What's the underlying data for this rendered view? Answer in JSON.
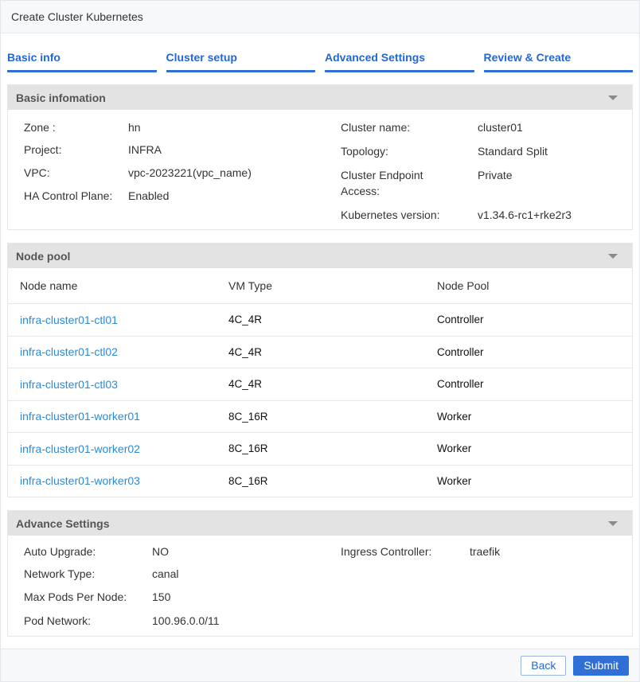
{
  "window": {
    "title": "Create Cluster Kubernetes"
  },
  "steps": [
    {
      "label": "Basic info"
    },
    {
      "label": "Cluster setup"
    },
    {
      "label": "Advanced Settings"
    },
    {
      "label": "Review & Create"
    }
  ],
  "basic": {
    "title": "Basic infomation",
    "left": [
      {
        "key": "Zone :",
        "value": "hn"
      },
      {
        "key": "Project:",
        "value": "INFRA"
      },
      {
        "key": "VPC:",
        "value": "vpc-2023221(vpc_name)"
      },
      {
        "key": "HA Control Plane:",
        "value": "Enabled"
      }
    ],
    "right": [
      {
        "key": "Cluster name:",
        "value": "cluster01"
      },
      {
        "key": "Topology:",
        "value": "Standard Split"
      },
      {
        "key_line1": "Cluster Endpoint",
        "key_line2": "Access:",
        "value": "Private"
      },
      {
        "key": "Kubernetes version:",
        "value": "v1.34.6-rc1+rke2r3"
      }
    ]
  },
  "nodepool": {
    "title": "Node pool",
    "headers": [
      "Node name",
      "VM Type",
      "Node Pool"
    ],
    "rows": [
      {
        "name": "infra-cluster01-ctl01",
        "vm": "4C_4R",
        "pool": "Controller"
      },
      {
        "name": "infra-cluster01-ctl02",
        "vm": "4C_4R",
        "pool": "Controller"
      },
      {
        "name": "infra-cluster01-ctl03",
        "vm": "4C_4R",
        "pool": "Controller"
      },
      {
        "name": "infra-cluster01-worker01",
        "vm": "8C_16R",
        "pool": "Worker"
      },
      {
        "name": "infra-cluster01-worker02",
        "vm": "8C_16R",
        "pool": "Worker"
      },
      {
        "name": "infra-cluster01-worker03",
        "vm": "8C_16R",
        "pool": "Worker"
      }
    ]
  },
  "advance": {
    "title": "Advance Settings",
    "left": [
      {
        "key": "Auto Upgrade:",
        "value": "NO"
      },
      {
        "key": "Network Type:",
        "value": "canal"
      },
      {
        "key": "Max Pods Per Node:",
        "value": "150"
      },
      {
        "key": "Pod Network:",
        "value": "100.96.0.0/11"
      }
    ],
    "right": [
      {
        "key": "Ingress Controller:",
        "value": "traefik"
      }
    ]
  },
  "footer": {
    "back_label": "Back",
    "submit_label": "Submit"
  },
  "icons": {
    "panel_toggle": "caret-down-icon"
  },
  "colors": {
    "accent": "#2f6fd6",
    "link": "#2a8ad8",
    "panel_header": "#e3e3e3"
  }
}
